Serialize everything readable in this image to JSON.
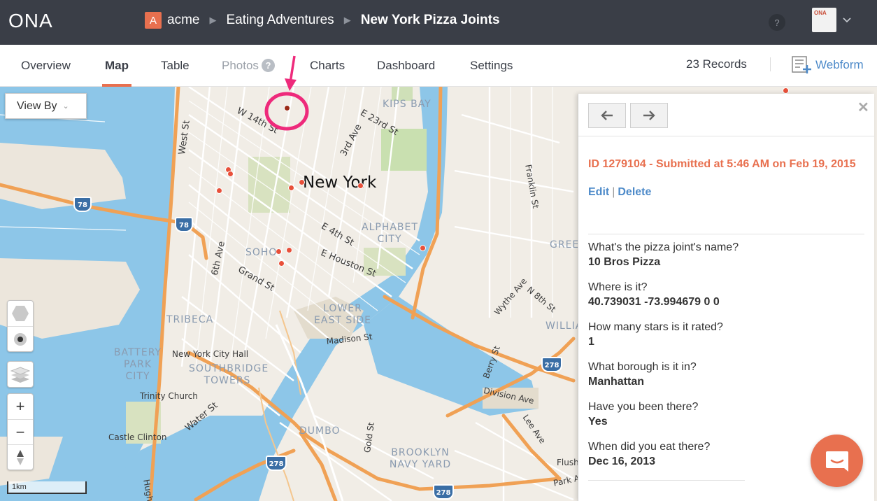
{
  "header": {
    "logo": "ONA",
    "org_badge": "A",
    "org_name": "acme",
    "project": "Eating Adventures",
    "form_title": "New York Pizza Joints",
    "help": "?",
    "org_logo_text": "ONA"
  },
  "tabs": {
    "overview": "Overview",
    "map": "Map",
    "table": "Table",
    "photos": "Photos",
    "photos_help": "?",
    "charts": "Charts",
    "dashboard": "Dashboard",
    "settings": "Settings",
    "active": "Map"
  },
  "toolbar": {
    "records": "23 Records",
    "webform": "Webform"
  },
  "map": {
    "view_by": "View By",
    "scale": "1km",
    "labels": {
      "city": "New York",
      "kips_bay": "KIPS BAY",
      "alphabet_city": "ALPHABET CITY",
      "soho": "SOHO",
      "lower_east_side": "LOWER EAST SIDE",
      "tribeca": "TRIBECA",
      "battery_park_city": "BATTERY PARK CITY",
      "southbridge_towers": "SOUTHBRIDGE TOWERS",
      "dumbo": "DUMBO",
      "brooklyn_navy_yard": "BROOKLYN NAVY YARD",
      "williams": "WILLIAMS",
      "green": "GREE",
      "city_hall": "New York City Hall",
      "trinity_church": "Trinity Church",
      "castle_clinton": "Castle Clinton",
      "w14": "W 14th St",
      "e23": "E 23rd St",
      "third_ave": "3rd Ave",
      "e4": "E 4th St",
      "e_houston": "E Houston St",
      "grand": "Grand St",
      "sixth_ave": "6th Ave",
      "west_st": "West St",
      "madison": "Madison St",
      "water": "Water St",
      "gold": "Gold St",
      "berry": "Berry St",
      "division": "Division Ave",
      "lee": "Lee Ave",
      "wythe": "Wythe Ave",
      "n8": "N 8th St",
      "franklin": "Franklin St",
      "flush": "Flush",
      "park_ave": "Park Ave",
      "hugh": "Hugh",
      "i78": "78",
      "i278": "278"
    }
  },
  "record": {
    "title": "ID 1279104 - Submitted at 5:46 AM on Feb 19, 2015",
    "edit": "Edit",
    "separator": "|",
    "delete": "Delete",
    "questions": [
      {
        "q": "What's the pizza joint's name?",
        "a": "10 Bros Pizza"
      },
      {
        "q": "Where is it?",
        "a": "40.739031 -73.994679 0 0"
      },
      {
        "q": "How many stars is it rated?",
        "a": "1"
      },
      {
        "q": "What borough is it in?",
        "a": "Manhattan"
      },
      {
        "q": "Have you been there?",
        "a": "Yes"
      },
      {
        "q": "When did you eat there?",
        "a": "Dec 16, 2013"
      }
    ]
  },
  "colors": {
    "accent": "#e8704f",
    "link": "#4d8ac9",
    "header_bg": "#3a3e47",
    "water": "#8dc6e8",
    "land": "#f1ede6",
    "highway": "#f0a155",
    "pin": "#e8503a",
    "highlight": "#ee2a7b"
  }
}
